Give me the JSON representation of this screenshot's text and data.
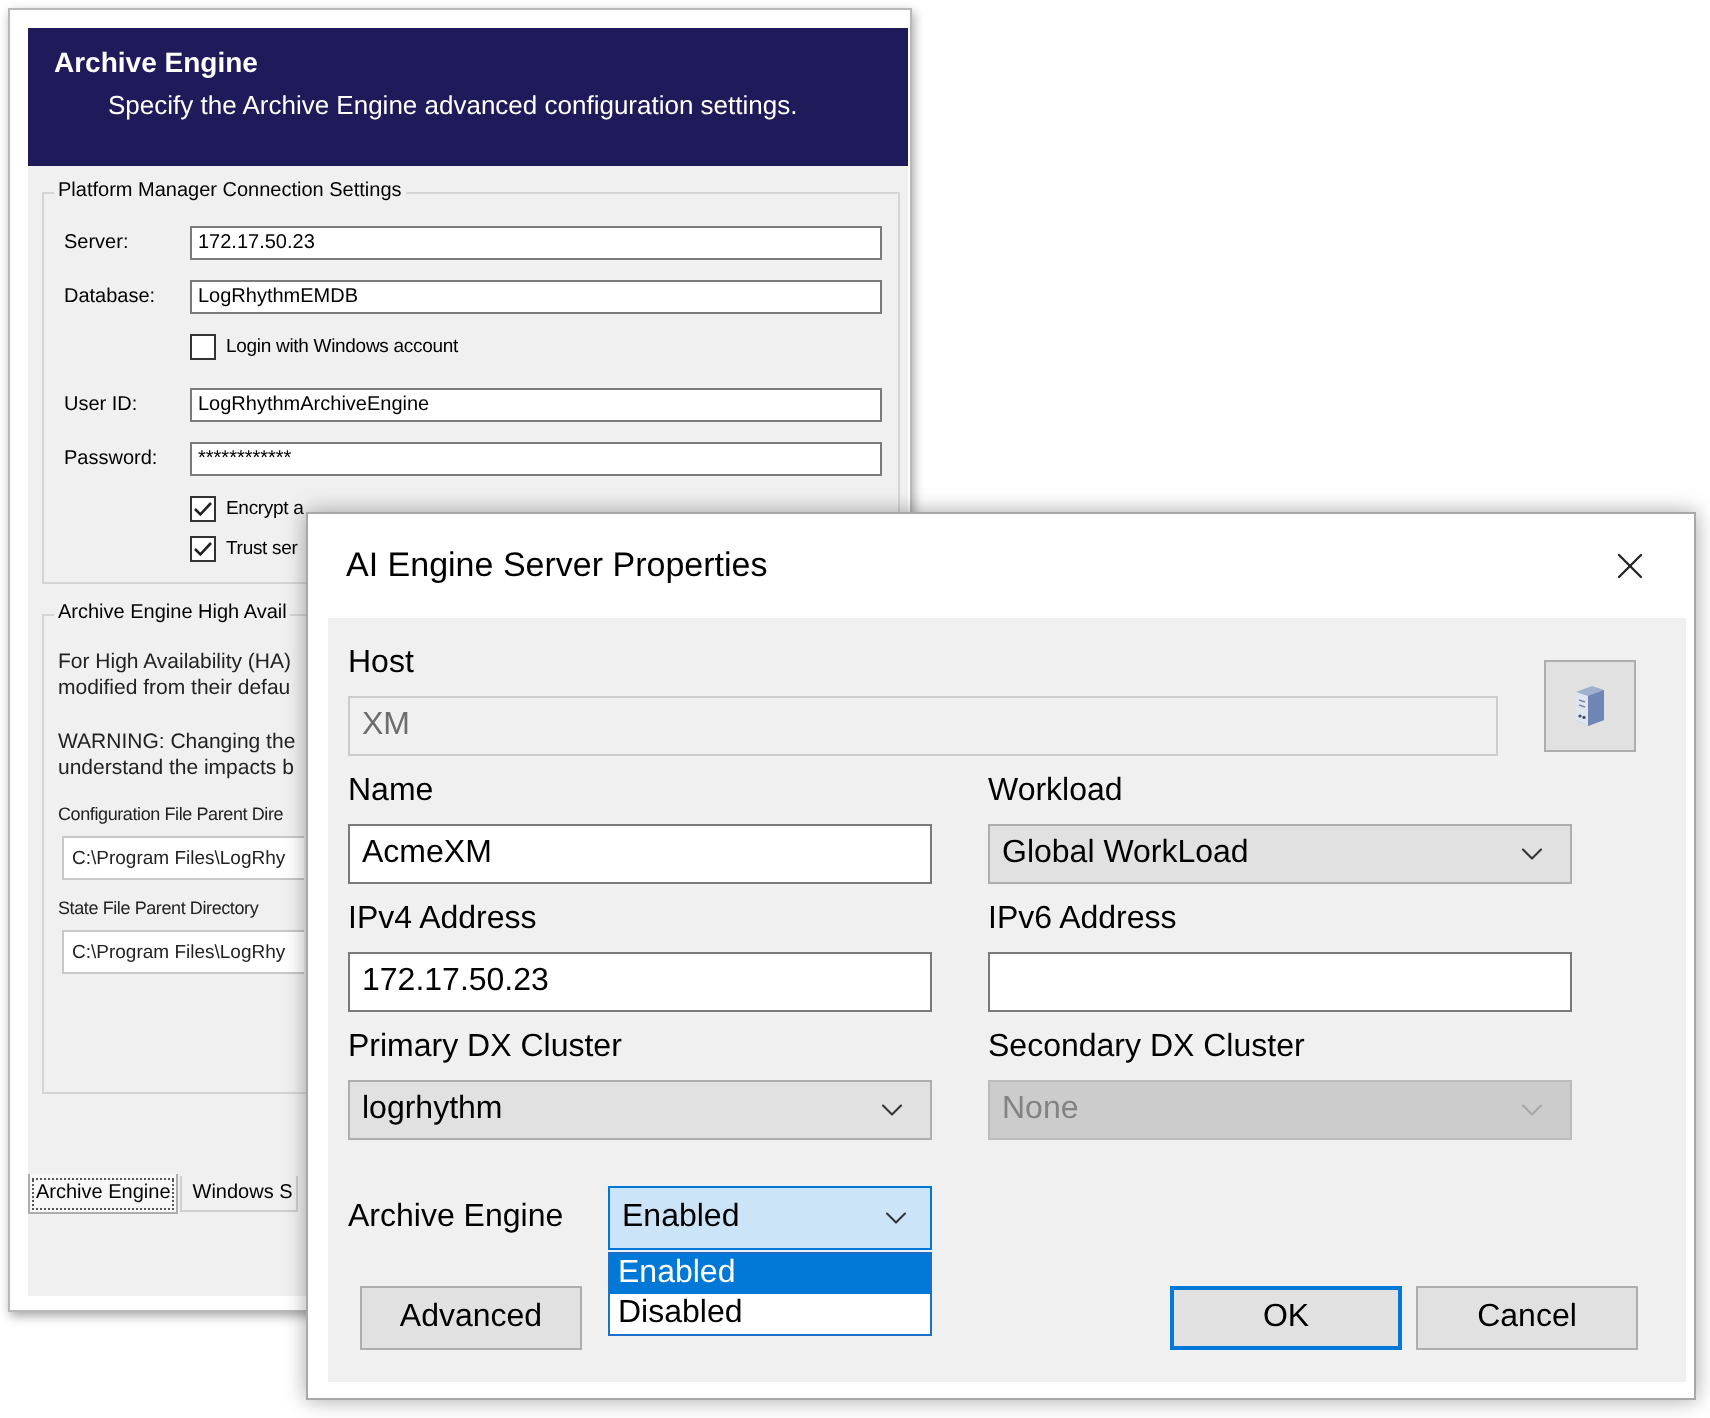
{
  "back_window": {
    "header": {
      "title": "Archive Engine",
      "subtitle": "Specify the Archive Engine advanced configuration settings."
    },
    "connection_group": {
      "title": "Platform Manager Connection Settings",
      "fields": [
        {
          "kind": "text",
          "label": "Server:",
          "value": "172.17.50.23"
        },
        {
          "kind": "text",
          "label": "Database:",
          "value": "LogRhythmEMDB"
        },
        {
          "kind": "checkbox",
          "label": "Login with Windows account",
          "checked": false
        },
        {
          "kind": "text",
          "label": "User ID:",
          "value": "LogRhythmArchiveEngine"
        },
        {
          "kind": "password",
          "label": "Password:",
          "value": "************"
        },
        {
          "kind": "checkbox",
          "label": "Encrypt a",
          "checked": true
        },
        {
          "kind": "checkbox",
          "label": "Trust ser",
          "checked": true
        }
      ]
    },
    "ha_group": {
      "title": "Archive Engine High Avail",
      "notes": [
        [
          "For High Availability (HA)",
          "modified from their defau"
        ],
        [
          "WARNING: Changing the",
          "understand the impacts b"
        ]
      ],
      "fields": [
        {
          "label": "Configuration File Parent Dire",
          "value": "C:\\Program Files\\LogRhy"
        },
        {
          "label": "State File Parent Directory",
          "value": "C:\\Program Files\\LogRhy"
        }
      ]
    },
    "tabs": [
      {
        "label": "Archive Engine",
        "selected": true
      },
      {
        "label": "Windows S",
        "selected": false
      }
    ]
  },
  "dialog": {
    "title": "AI Engine Server Properties",
    "host": {
      "label": "Host",
      "value": "XM",
      "disabled": true
    },
    "fields": [
      {
        "kind": "text",
        "label": "Name",
        "value": "AcmeXM",
        "disabled": false
      },
      {
        "kind": "select",
        "label": "Workload",
        "value": "Global WorkLoad",
        "disabled": false
      },
      {
        "kind": "text",
        "label": "IPv4 Address",
        "value": "172.17.50.23",
        "disabled": false
      },
      {
        "kind": "text",
        "label": "IPv6 Address",
        "disabled": false
      },
      {
        "kind": "select",
        "label": "Primary DX Cluster",
        "value": "logrhythm",
        "disabled": false
      },
      {
        "kind": "select",
        "label": "Secondary DX Cluster",
        "value": "None",
        "disabled": true
      }
    ],
    "archive_engine": {
      "label": "Archive Engine",
      "value": "Enabled",
      "expanded": true,
      "options": [
        {
          "label": "Enabled",
          "selected": true
        },
        {
          "label": "Disabled",
          "selected": false
        }
      ]
    },
    "advanced_button": {
      "label": "Advanced"
    },
    "buttons": [
      {
        "label": "OK",
        "default": true
      },
      {
        "label": "Cancel",
        "default": false
      }
    ]
  }
}
